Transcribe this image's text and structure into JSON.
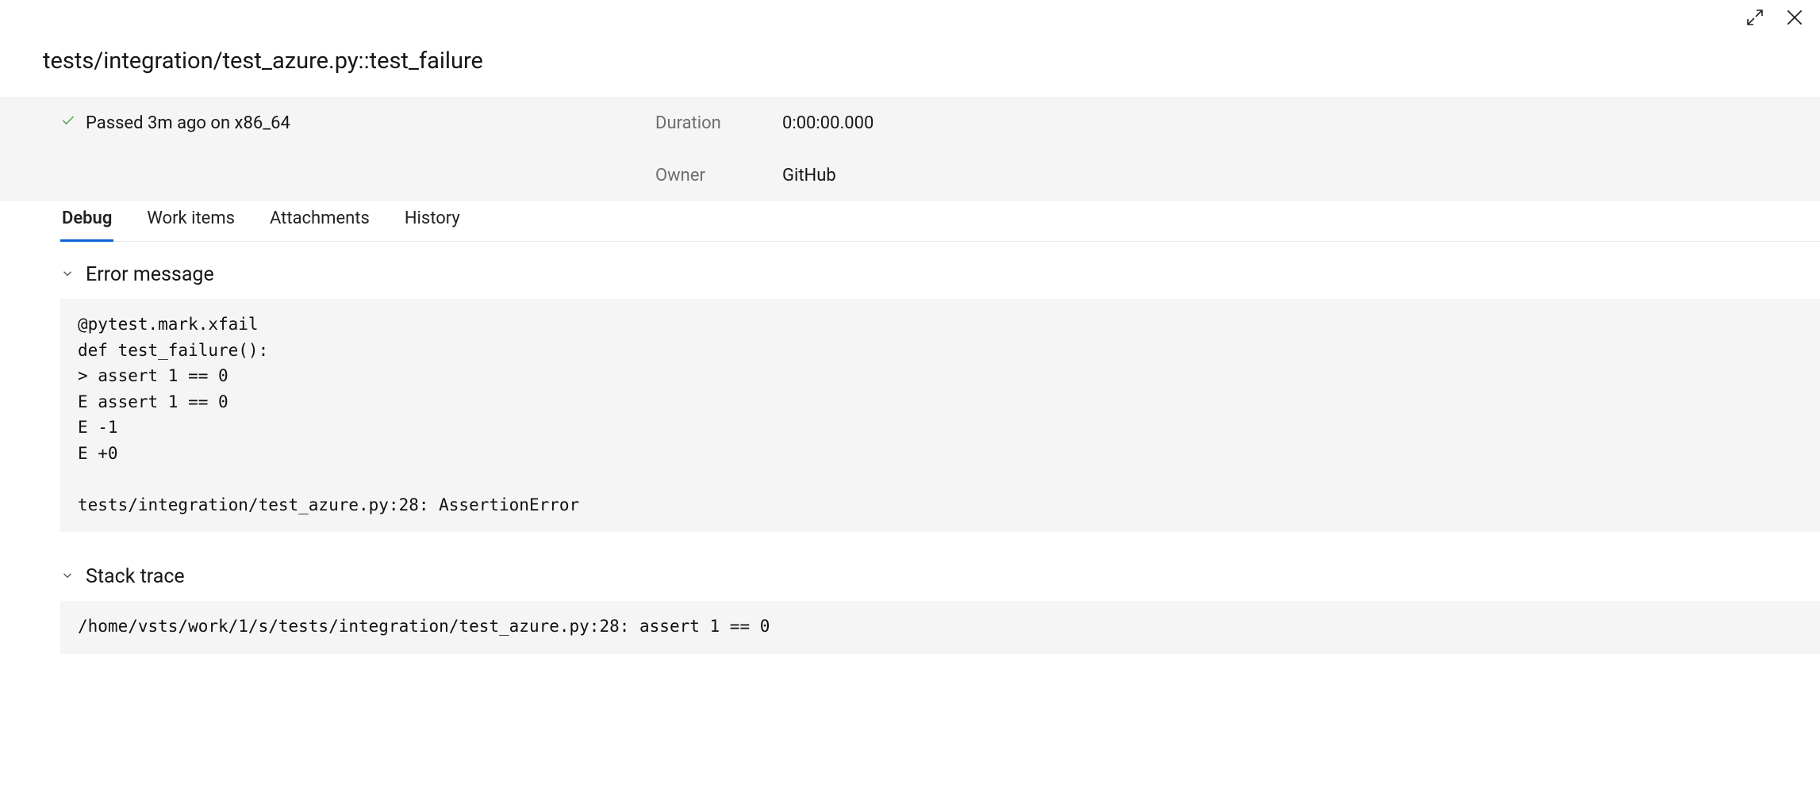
{
  "title": "tests/integration/test_azure.py::test_failure",
  "status": {
    "text": "Passed 3m ago on x86_64"
  },
  "meta": {
    "duration": {
      "label": "Duration",
      "value": "0:00:00.000"
    },
    "owner": {
      "label": "Owner",
      "value": "GitHub"
    }
  },
  "tabs": {
    "debug": "Debug",
    "work_items": "Work items",
    "attachments": "Attachments",
    "history": "History"
  },
  "sections": {
    "error": {
      "heading": "Error message",
      "body": "@pytest.mark.xfail\ndef test_failure():\n> assert 1 == 0\nE assert 1 == 0\nE -1\nE +0\n\ntests/integration/test_azure.py:28: AssertionError"
    },
    "stack": {
      "heading": "Stack trace",
      "body": "/home/vsts/work/1/s/tests/integration/test_azure.py:28: assert 1 == 0"
    }
  }
}
